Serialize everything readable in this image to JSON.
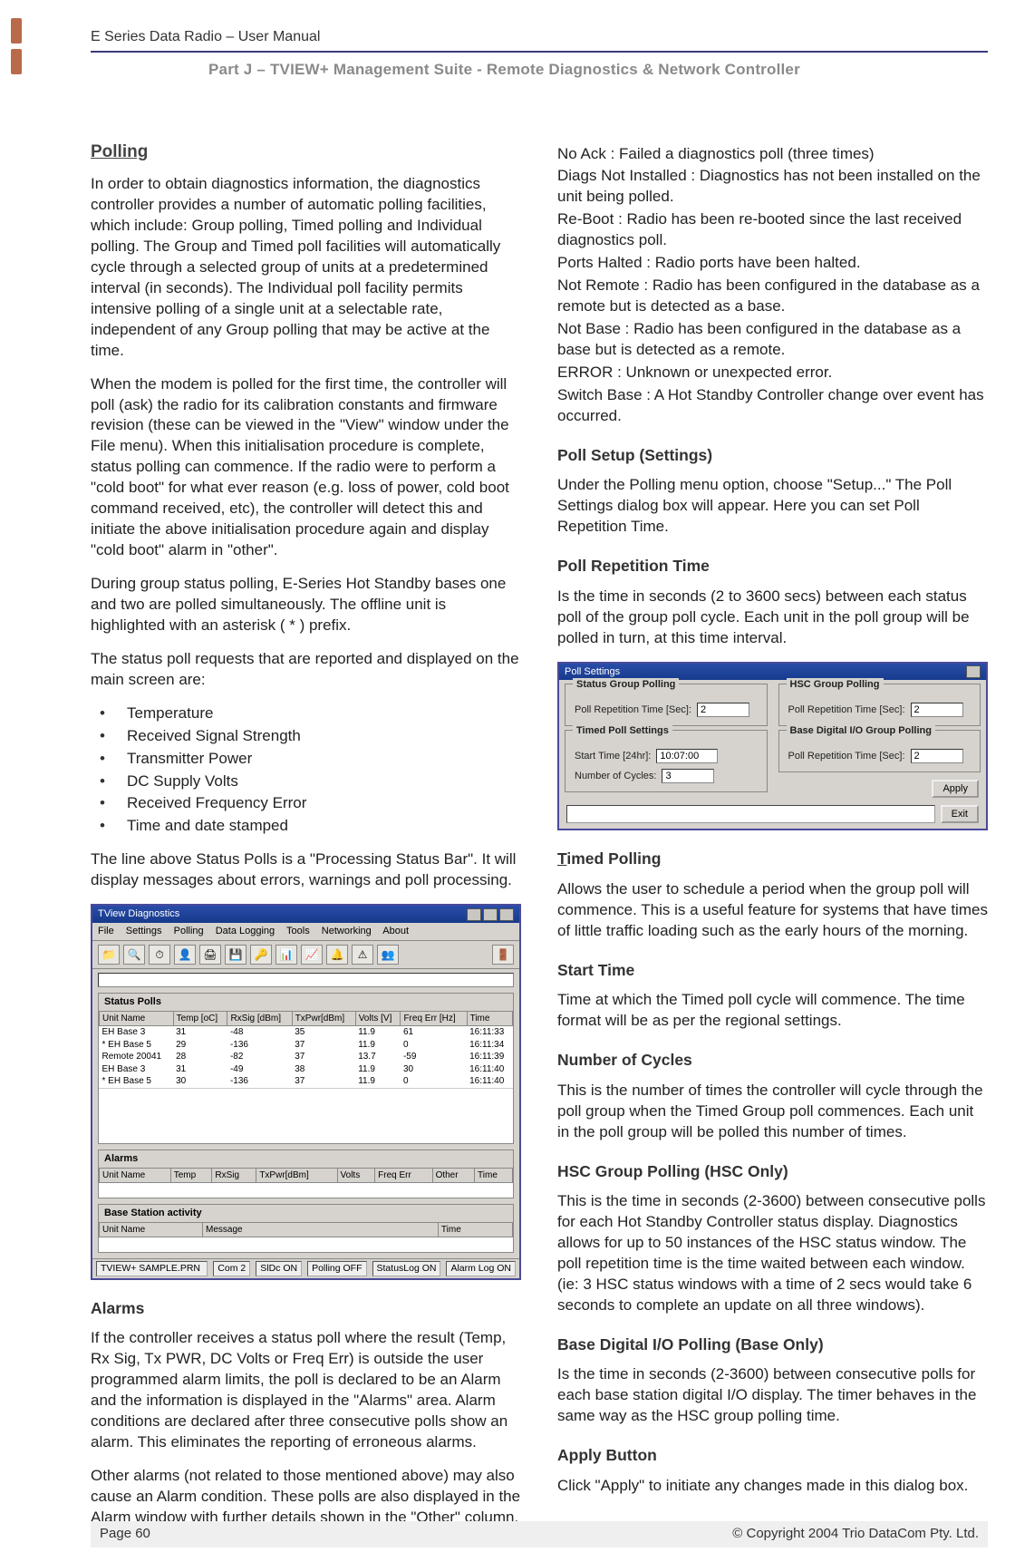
{
  "header": {
    "title": "E Series Data Radio – User Manual",
    "part_line": "Part J – TVIEW+ Management Suite -  Remote Diagnostics & Network Controller"
  },
  "left": {
    "h_polling": "Polling",
    "p1": "In order to obtain diagnostics information, the diagnostics controller provides a number of automatic polling facilities, which include: Group polling, Timed polling and Individual polling.  The Group and Timed poll facilities will automatically cycle through a selected group of units at a predetermined interval (in seconds).  The Individual poll facility permits intensive polling of a single unit at a selectable rate, independent of any Group polling that may be active at the time.",
    "p2": "When the modem is polled for the first time, the controller will poll (ask) the radio for its calibration constants and firmware revision (these can be viewed in the \"View\" window under the File menu).  When this initialisation procedure is complete, status polling can commence.  If the radio were to perform a \"cold boot\" for what ever reason (e.g. loss of power, cold boot command received, etc), the controller will detect this and initiate the above initialisation procedure again and display \"cold boot\" alarm in \"other\".",
    "p3": "During group status polling, E-Series Hot Standby bases one and two are polled simultaneously. The offline unit is highlighted with an asterisk ( * ) prefix.",
    "p4": "The status poll requests that are reported and displayed on the main screen are:",
    "bullets": [
      "Temperature",
      "Received Signal Strength",
      "Transmitter Power",
      "DC Supply Volts",
      "Received Frequency Error",
      "Time and date stamped"
    ],
    "p5": "The line above Status Polls is a \"Processing Status Bar\".  It will display messages about errors, warnings and poll processing.",
    "h_alarms": "Alarms",
    "p6": "If the controller receives a status poll where the result (Temp, Rx Sig, Tx PWR, DC Volts or Freq Err) is outside the user programmed alarm limits, the poll is declared to be an Alarm and the information is displayed in the \"Alarms\" area. Alarm conditions are declared after three consecutive polls show an alarm. This eliminates the reporting of erroneous alarms.",
    "p7": "Other alarms (not related to those mentioned above) may also cause an Alarm condition. These polls are also displayed in the Alarm window with further details shown in the \"Other\" column. The alarm types are:"
  },
  "right": {
    "p1": "No Ack : Failed a diagnostics poll (three times)",
    "p2": "Diags Not Installed : Diagnostics has not been installed on the unit being polled.",
    "p3": "Re-Boot : Radio has been re-booted since the last received diagnostics poll.",
    "p4": "Ports Halted : Radio ports have been halted.",
    "p5": "Not Remote : Radio has been configured in the database as a remote but is detected as a base.",
    "p6": "Not Base : Radio has been configured in the database as a base but is detected as a remote.",
    "p7": "ERROR : Unknown or unexpected error.",
    "p8": "Switch Base : A Hot Standby Controller change over event has occurred.",
    "h_setup": "Poll Setup (Settings)",
    "p_setup": "Under the Polling menu option, choose \"Setup...\"  The Poll Settings dialog box will appear.  Here you can set  Poll Repetition Time.",
    "h_rep": "Poll Repetition Time",
    "p_rep": "Is the time in seconds (2 to 3600 secs) between each status poll of the group poll cycle.  Each unit in the poll group will be polled in turn, at this time interval.",
    "h_timed": "Timed Polling",
    "p_timed": "Allows the user to schedule a period when the group poll will commence.  This is a useful feature for systems that have times of little traffic loading such as the early hours of the morning.",
    "h_start": "Start Time",
    "p_start": "Time at which the Timed poll cycle will commence. The time format will be as per the regional settings.",
    "h_cycles": "Number of Cycles",
    "p_cycles": "This is the number of times the controller will cycle through the poll group when the Timed Group poll commences. Each unit in the poll group will be polled this number of times.",
    "h_hsc": "HSC Group Polling (HSC Only)",
    "p_hsc": "This is the time in seconds (2-3600) between consecutive polls for each Hot Standby Controller status display. Diagnostics allows for up to 50 instances of the HSC status window. The poll repetition time is the time waited between each window. (ie: 3 HSC status windows with a time of 2 secs would take 6 seconds to complete an update on all three windows).",
    "h_bdio": "Base Digital I/O Polling (Base Only)",
    "p_bdio": "Is the time in seconds (2-3600) between consecutive polls for each base station digital I/O display. The timer behaves in the same way as the HSC group polling time.",
    "h_apply": "Apply Button",
    "p_apply": "Click \"Apply\" to initiate any changes made in this dialog box."
  },
  "tview": {
    "title": "TView Diagnostics",
    "menus": [
      "File",
      "Settings",
      "Polling",
      "Data Logging",
      "Tools",
      "Networking",
      "About"
    ],
    "status_polls_title": "Status Polls",
    "cols": [
      "Unit Name",
      "Temp [oC]",
      "RxSig [dBm]",
      "TxPwr[dBm]",
      "Volts [V]",
      "Freq Err [Hz]",
      "Time"
    ],
    "rows": [
      [
        "EH Base 3",
        "31",
        "-48",
        "35",
        "11.9",
        "61",
        "16:11:33"
      ],
      [
        "* EH Base 5",
        "29",
        "-136",
        "37",
        "11.9",
        "0",
        "16:11:34"
      ],
      [
        "Remote 20041",
        "28",
        "-82",
        "37",
        "13.7",
        "-59",
        "16:11:39"
      ],
      [
        "EH Base 3",
        "31",
        "-49",
        "38",
        "11.9",
        "30",
        "16:11:40"
      ],
      [
        "* EH Base 5",
        "30",
        "-136",
        "37",
        "11.9",
        "0",
        "16:11:40"
      ]
    ],
    "alarms_title": "Alarms",
    "alarm_cols": [
      "Unit Name",
      "Temp",
      "RxSig",
      "TxPwr[dBm]",
      "Volts",
      "Freq Err",
      "Other",
      "Time"
    ],
    "base_title": "Base Station activity",
    "base_cols": [
      "Unit Name",
      "Message",
      "Time"
    ],
    "statusbar": [
      "TVIEW+ SAMPLE.PRN",
      "Com 2",
      "SlDc ON",
      "Polling OFF",
      "StatusLog ON",
      "Alarm Log ON"
    ]
  },
  "pollset": {
    "title": "Poll Settings",
    "g1": "Status Group Polling",
    "g1_label": "Poll Repetition Time [Sec]:",
    "g1_val": "2",
    "g2": "Timed Poll Settings",
    "g2_start_label": "Start Time [24hr]:",
    "g2_start_val": "10:07:00",
    "g2_cycles_label": "Number of Cycles:",
    "g2_cycles_val": "3",
    "g3": "HSC Group Polling",
    "g3_label": "Poll Repetition Time [Sec]:",
    "g3_val": "2",
    "g4": "Base Digital I/O Group Polling",
    "g4_label": "Poll Repetition Time [Sec]:",
    "g4_val": "2",
    "apply": "Apply",
    "exit": "Exit"
  },
  "footer": {
    "page": "Page 60",
    "copyright": "© Copyright 2004 Trio DataCom Pty. Ltd."
  }
}
